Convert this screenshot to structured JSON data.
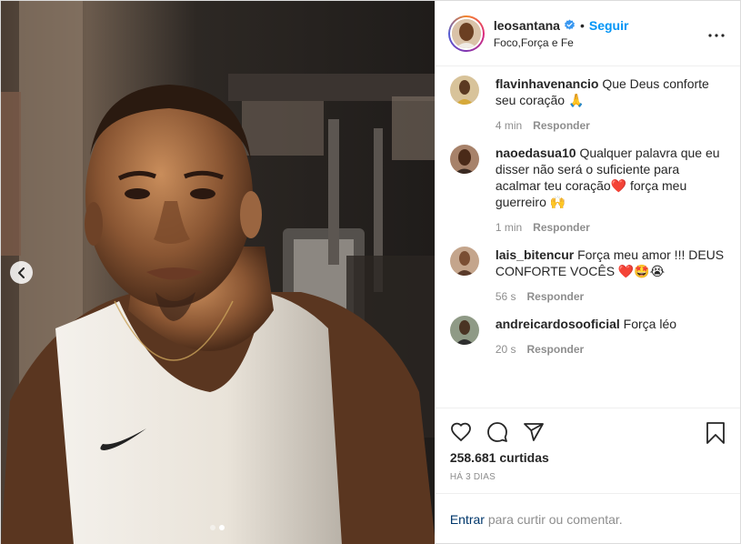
{
  "header": {
    "username": "leosantana",
    "separator": "•",
    "follow_label": "Seguir",
    "location": "Foco,Força e Fe",
    "more_icon": "more-horizontal-icon",
    "verified_icon": "verified-badge-icon"
  },
  "comments": [
    {
      "user": "flavinhavenancio",
      "text": "Que Deus conforte seu coração 🙏",
      "time": "4 min",
      "reply_label": "Responder"
    },
    {
      "user": "naoedasua10",
      "text": "Qualquer palavra que eu disser não será o suficiente para acalmar teu coração❤️ força meu guerreiro 🙌",
      "time": "1 min",
      "reply_label": "Responder"
    },
    {
      "user": "lais_bitencur",
      "text": "Força meu amor !!! DEUS CONFORTE VOCÊS ❤️🤩😭",
      "time": "56 s",
      "reply_label": "Responder"
    },
    {
      "user": "andreicardosooficial",
      "text": "Força léo",
      "time": "20 s",
      "reply_label": "Responder"
    }
  ],
  "actions": {
    "like_icon": "heart-icon",
    "comment_icon": "comment-icon",
    "share_icon": "share-icon",
    "save_icon": "bookmark-icon"
  },
  "likes": "258.681 curtidas",
  "date": "HÁ 3 DIAS",
  "add_comment": {
    "login_label": "Entrar",
    "rest": " para curtir ou comentar."
  },
  "media": {
    "prev_icon": "chevron-left-icon",
    "slide_count": 2,
    "active_slide": 2
  },
  "colors": {
    "accent": "#0095f6",
    "link_dark": "#00376b",
    "muted": "#8e8e8e"
  }
}
